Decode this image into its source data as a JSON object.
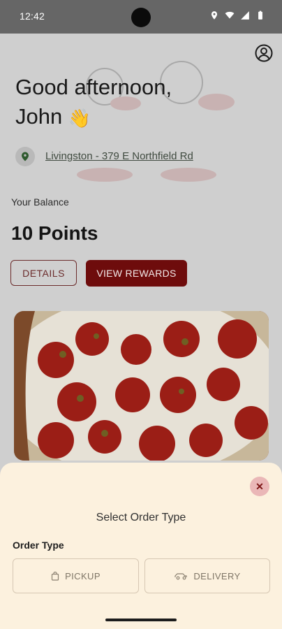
{
  "status_bar": {
    "time": "12:42",
    "icons": [
      "location-icon",
      "wifi-icon",
      "signal-icon",
      "battery-icon"
    ]
  },
  "header": {
    "greeting_line1": "Good afternoon,",
    "greeting_line2": "John",
    "wave_emoji": "👋"
  },
  "location": {
    "text": "Livingston - 379 E Northfield Rd"
  },
  "balance": {
    "label": "Your Balance",
    "value": "10 Points"
  },
  "buttons": {
    "details": "DETAILS",
    "view_rewards": "VIEW REWARDS"
  },
  "order_sheet": {
    "close": "✕",
    "title": "Select Order Type",
    "order_type_label": "Order Type",
    "options": [
      "PICKUP",
      "DELIVERY"
    ]
  },
  "colors": {
    "brand": "#6e0c0c",
    "sheet_bg": "#fcf1de",
    "close_bg": "#eab7b7"
  }
}
